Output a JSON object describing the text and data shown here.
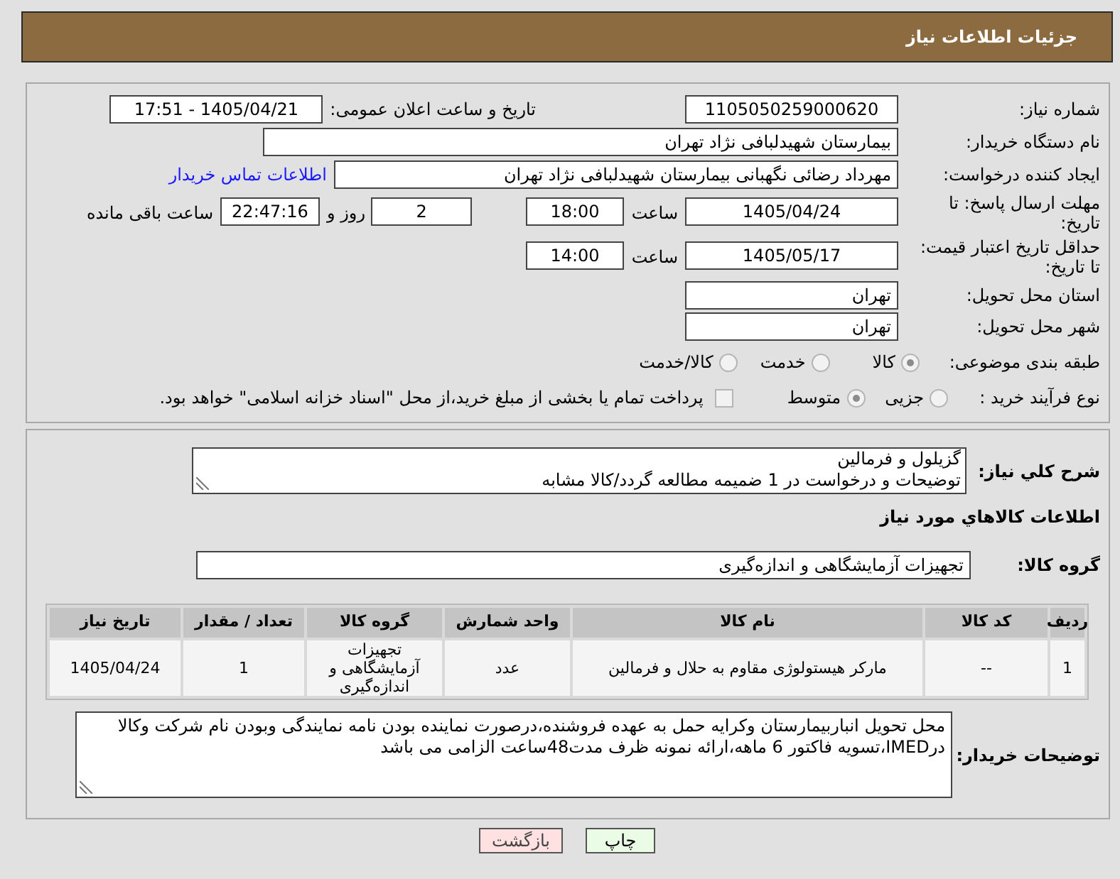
{
  "header": {
    "title": "جزئیات اطلاعات نیاز"
  },
  "details": {
    "need_number": {
      "label": "شماره نیاز:",
      "value": "1105050259000620"
    },
    "announce_datetime": {
      "label": "تاریخ و ساعت اعلان عمومی:",
      "value": "1405/04/21 - 17:51"
    },
    "buyer_org": {
      "label": "نام دستگاه خریدار:",
      "value": "بیمارستان شهیدلبافی نژاد تهران"
    },
    "requester": {
      "label": "ایجاد کننده درخواست:",
      "value": "مهرداد رضائی نگهبانی بیمارستان شهیدلبافی نژاد تهران",
      "link": "اطلاعات تماس خریدار"
    },
    "response_deadline": {
      "label": "مهلت ارسال پاسخ: تا تاریخ:",
      "date": "1405/04/24",
      "time_label": "ساعت",
      "time": "18:00",
      "days": "2",
      "days_label": "روز و",
      "remaining": "22:47:16",
      "remaining_label": "ساعت باقی مانده"
    },
    "price_validity": {
      "label": "حداقل تاریخ اعتبار قیمت: تا تاریخ:",
      "date": "1405/05/17",
      "time_label": "ساعت",
      "time": "14:00"
    },
    "province": {
      "label": "استان محل تحویل:",
      "value": "تهران"
    },
    "city": {
      "label": "شهر محل تحویل:",
      "value": "تهران"
    },
    "category": {
      "label": "طبقه بندی موضوعی:",
      "options": [
        {
          "label": "کالا",
          "selected": true
        },
        {
          "label": "خدمت",
          "selected": false
        },
        {
          "label": "کالا/خدمت",
          "selected": false
        }
      ]
    },
    "process": {
      "label": "نوع فرآیند خرید :",
      "options": [
        {
          "label": "جزیی",
          "selected": false
        },
        {
          "label": "متوسط",
          "selected": true
        }
      ],
      "treasury": {
        "checked": false,
        "text": "پرداخت تمام یا بخشی از مبلغ خرید،از محل \"اسناد خزانه اسلامی\" خواهد بود."
      }
    }
  },
  "summary": {
    "label": "شرح کلي نیاز:",
    "text": "گزیلول و فرمالین\nتوضیحات و درخواست در 1 ضمیمه مطالعه گردد/کالا مشابه"
  },
  "goods": {
    "title": "اطلاعات کالاهاي مورد نیاز",
    "group_label": "گروه کالا:",
    "group_value": "تجهیزات آزمایشگاهی و اندازه‌گیری",
    "table": {
      "columns": [
        "ردیف",
        "کد کالا",
        "نام کالا",
        "واحد شمارش",
        "گروه کالا",
        "تعداد / مقدار",
        "تاریخ نیاز"
      ],
      "rows": [
        [
          "1",
          "--",
          "مارکر هیستولوژی مقاوم به حلال و فرمالین",
          "عدد",
          "تجهیزات آزمایشگاهی و اندازه‌گیری",
          "1",
          "1405/04/24"
        ]
      ]
    }
  },
  "buyer_notes": {
    "label": "توضیحات خریدار:",
    "text": "محل تحویل انباربیمارستان وکرایه حمل به عهده فروشنده،درصورت نماینده بودن نامه نمایندگی وبودن نام شرکت وکالا درIMED،تسویه فاکتور 6 ماهه،ارائه نمونه ظرف مدت48ساعت الزامی می باشد"
  },
  "buttons": [
    {
      "kind": "print",
      "label": "چاپ"
    },
    {
      "kind": "back",
      "label": "بازگشت"
    }
  ]
}
